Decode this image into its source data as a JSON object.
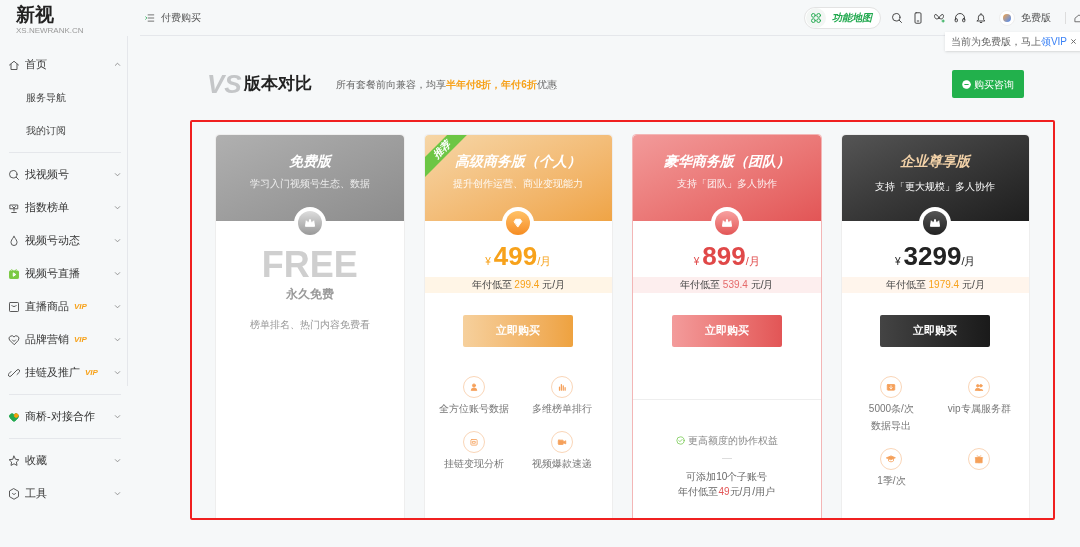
{
  "logo": {
    "name": "新视",
    "domain": "XS.NEWRANK.CN"
  },
  "breadcrumb": "付费购买",
  "header": {
    "feature_map": "功能地图",
    "plan": "免费版",
    "tooltip": {
      "text": "当前为免费版，马上",
      "link": "领VIP"
    }
  },
  "sidebar": {
    "groups": [
      [
        {
          "label": "首页",
          "expanded": true,
          "children": [
            {
              "label": "服务导航"
            },
            {
              "label": "我的订阅"
            }
          ]
        }
      ],
      [
        {
          "label": "找视频号",
          "expanded": false
        },
        {
          "label": "指数榜单",
          "expanded": false
        },
        {
          "label": "视频号动态",
          "expanded": false
        },
        {
          "label": "视频号直播",
          "expanded": false
        },
        {
          "label": "直播商品",
          "expanded": false,
          "tag": "VIP"
        },
        {
          "label": "品牌营销",
          "expanded": false,
          "tag": "VIP"
        },
        {
          "label": "挂链及推广",
          "expanded": false,
          "tag": "VIP"
        }
      ],
      [
        {
          "label": "商桥-对接合作",
          "expanded": false
        }
      ],
      [
        {
          "label": "收藏",
          "expanded": false
        },
        {
          "label": "工具",
          "expanded": false
        }
      ]
    ]
  },
  "heading": {
    "mark": "VS",
    "title": "版本对比",
    "note": "所有套餐前向兼容，均享**半年付8折，年付6折**优惠"
  },
  "consult_button": "购买咨询",
  "plans": [
    {
      "kind": "free",
      "name": "免费版",
      "tagline": "学习入门视频号生态、数据",
      "big_text": "FREE",
      "label": "永久免费",
      "desc": "榜单排名、热门内容免费看"
    },
    {
      "kind": "orange",
      "badge": "推荐",
      "name": "高级商务版（个人）",
      "tagline": "提升创作运营、商业变现能力",
      "currency": "¥",
      "price": "499",
      "unit": "/月",
      "annual": {
        "prefix": "年付低至",
        "value": "299.4",
        "suffix": "元/月"
      },
      "button": "立即购买",
      "features": [
        {
          "kind": "labeled",
          "lines": [
            "全方位账号数据"
          ]
        },
        {
          "kind": "labeled",
          "lines": [
            "多维榜单排行"
          ]
        },
        {
          "kind": "labeled",
          "lines": [
            "挂链变现分析"
          ]
        },
        {
          "kind": "labeled",
          "lines": [
            "视频爆款速递"
          ]
        }
      ]
    },
    {
      "kind": "red",
      "name": "豪华商务版（团队）",
      "tagline": "支持「团队」多人协作",
      "currency": "¥",
      "price": "899",
      "unit": "/月",
      "annual": {
        "prefix": "年付低至",
        "value": "539.4",
        "suffix": "元/月"
      },
      "button": "立即购买",
      "benefit": "更高额度的协作权益",
      "notes": [
        "可添加10个子账号",
        "年付低至**49**元/月/用户"
      ]
    },
    {
      "kind": "dark",
      "name": "企业尊享版",
      "tagline": "支持「更大规模」多人协作",
      "currency": "¥",
      "price": "3299",
      "unit": "/月",
      "annual": {
        "prefix": "年付低至",
        "value": "1979.4",
        "suffix": "元/月"
      },
      "button": "立即购买",
      "features": [
        {
          "kind": "labeled",
          "lines": [
            "5000条/次",
            "数据导出"
          ]
        },
        {
          "kind": "labeled",
          "lines": [
            "vip专属服务群"
          ]
        },
        {
          "kind": "labeled",
          "lines": [
            "1季/次"
          ]
        },
        {
          "kind": "icon_only"
        }
      ]
    }
  ]
}
